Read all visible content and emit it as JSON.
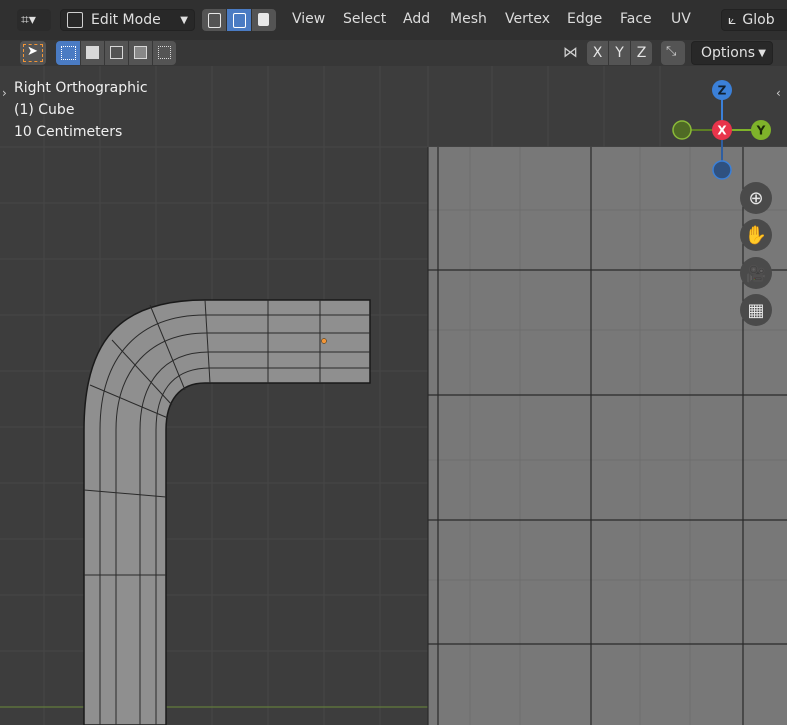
{
  "header": {
    "mode": "Edit Mode",
    "menu": [
      "View",
      "Select",
      "Add",
      "Mesh",
      "Vertex",
      "Edge",
      "Face",
      "UV"
    ],
    "transform_orientation": "Glob",
    "options_label": "Options",
    "axes": [
      "X",
      "Y",
      "Z"
    ]
  },
  "overlay": {
    "view_name": "Right Orthographic",
    "object_name": "(1) Cube",
    "scale": "10 Centimeters"
  },
  "gizmo": {
    "z": "Z",
    "x": "X",
    "y": "Y"
  },
  "colors": {
    "z_axis": "#3b80d8",
    "x_axis": "#e8344b",
    "y_axis": "#7fb32a",
    "selected": "#f29537",
    "active_mode": "#4a7bc3"
  }
}
